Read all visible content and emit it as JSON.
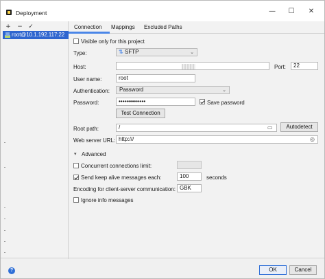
{
  "window": {
    "title": "Deployment"
  },
  "left_toolbar": {
    "add": "+",
    "remove": "−",
    "check": "✓"
  },
  "servers": [
    {
      "label": "root@10.1.192.117:22"
    }
  ],
  "tabs": [
    {
      "label": "Connection",
      "active": true
    },
    {
      "label": "Mappings",
      "active": false
    },
    {
      "label": "Excluded Paths",
      "active": false
    }
  ],
  "connection": {
    "visible_only": {
      "label": "Visible only for this project",
      "checked": false
    },
    "type": {
      "label": "Type:",
      "value": "SFTP"
    },
    "host": {
      "label": "Host:",
      "value": ""
    },
    "port": {
      "label": "Port:",
      "value": "22"
    },
    "user_name": {
      "label": "User name:",
      "value": "root"
    },
    "authentication": {
      "label": "Authentication:",
      "value": "Password"
    },
    "password": {
      "label": "Password:",
      "value": "••••••••••••••",
      "save_label": "Save password",
      "save_checked": true
    },
    "test_connection": "Test Connection",
    "root_path": {
      "label": "Root path:",
      "value": "/",
      "autodetect": "Autodetect"
    },
    "web_server_url": {
      "label": "Web server URL:",
      "value": "http:///"
    }
  },
  "advanced": {
    "title": "Advanced",
    "concurrent": {
      "label": "Concurrent connections limit:",
      "checked": false,
      "value": ""
    },
    "keep_alive": {
      "label": "Send keep alive messages each:",
      "checked": true,
      "value": "100",
      "unit": "seconds"
    },
    "encoding": {
      "label": "Encoding for client-server communication:",
      "value": "GBK"
    },
    "ignore_info": {
      "label": "Ignore info messages",
      "checked": false
    }
  },
  "footer": {
    "ok": "OK",
    "cancel": "Cancel",
    "help": "?"
  },
  "colors": {
    "accent": "#2e65cf",
    "tab_indicator": "#4a86e8"
  }
}
